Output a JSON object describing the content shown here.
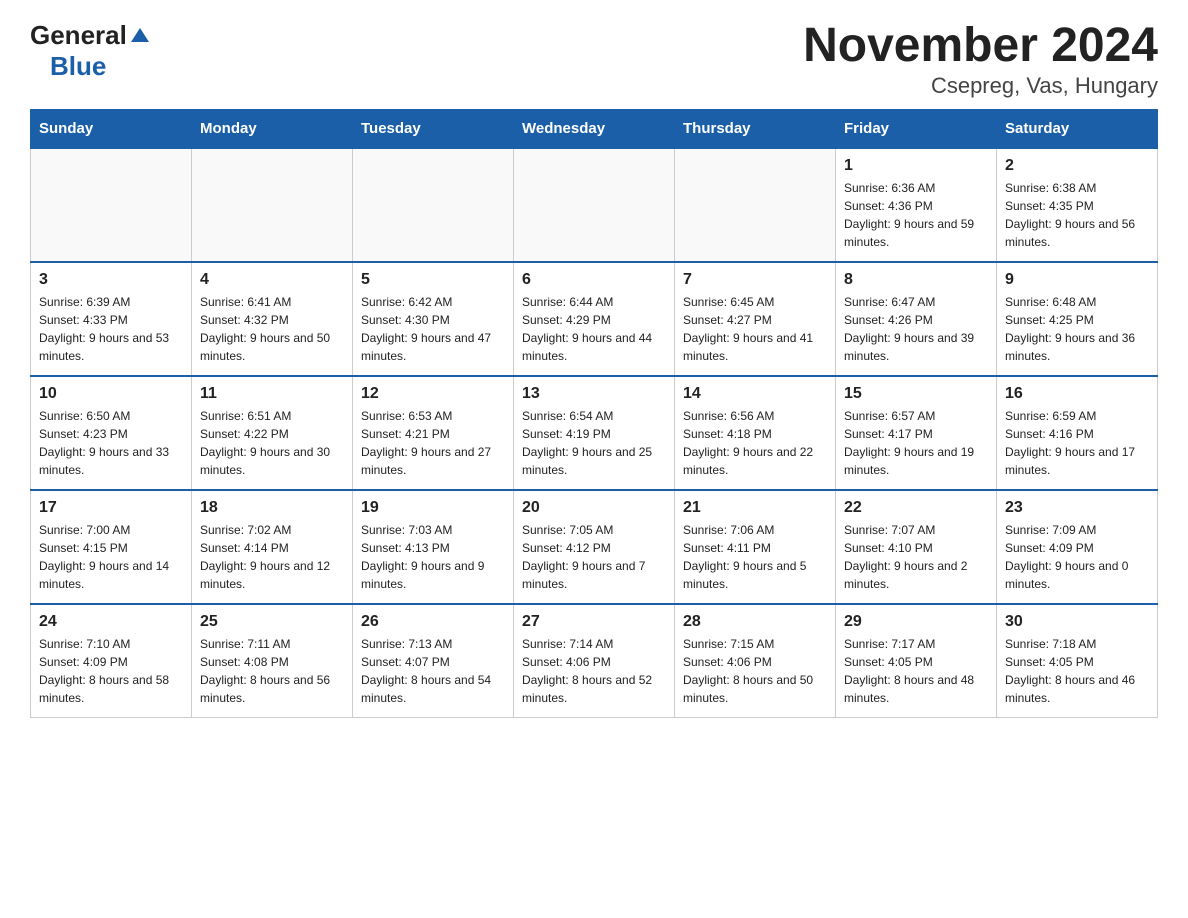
{
  "header": {
    "logo_general": "General",
    "logo_blue": "Blue",
    "title": "November 2024",
    "subtitle": "Csepreg, Vas, Hungary"
  },
  "weekdays": [
    "Sunday",
    "Monday",
    "Tuesday",
    "Wednesday",
    "Thursday",
    "Friday",
    "Saturday"
  ],
  "weeks": [
    [
      {
        "day": "",
        "sunrise": "",
        "sunset": "",
        "daylight": ""
      },
      {
        "day": "",
        "sunrise": "",
        "sunset": "",
        "daylight": ""
      },
      {
        "day": "",
        "sunrise": "",
        "sunset": "",
        "daylight": ""
      },
      {
        "day": "",
        "sunrise": "",
        "sunset": "",
        "daylight": ""
      },
      {
        "day": "",
        "sunrise": "",
        "sunset": "",
        "daylight": ""
      },
      {
        "day": "1",
        "sunrise": "Sunrise: 6:36 AM",
        "sunset": "Sunset: 4:36 PM",
        "daylight": "Daylight: 9 hours and 59 minutes."
      },
      {
        "day": "2",
        "sunrise": "Sunrise: 6:38 AM",
        "sunset": "Sunset: 4:35 PM",
        "daylight": "Daylight: 9 hours and 56 minutes."
      }
    ],
    [
      {
        "day": "3",
        "sunrise": "Sunrise: 6:39 AM",
        "sunset": "Sunset: 4:33 PM",
        "daylight": "Daylight: 9 hours and 53 minutes."
      },
      {
        "day": "4",
        "sunrise": "Sunrise: 6:41 AM",
        "sunset": "Sunset: 4:32 PM",
        "daylight": "Daylight: 9 hours and 50 minutes."
      },
      {
        "day": "5",
        "sunrise": "Sunrise: 6:42 AM",
        "sunset": "Sunset: 4:30 PM",
        "daylight": "Daylight: 9 hours and 47 minutes."
      },
      {
        "day": "6",
        "sunrise": "Sunrise: 6:44 AM",
        "sunset": "Sunset: 4:29 PM",
        "daylight": "Daylight: 9 hours and 44 minutes."
      },
      {
        "day": "7",
        "sunrise": "Sunrise: 6:45 AM",
        "sunset": "Sunset: 4:27 PM",
        "daylight": "Daylight: 9 hours and 41 minutes."
      },
      {
        "day": "8",
        "sunrise": "Sunrise: 6:47 AM",
        "sunset": "Sunset: 4:26 PM",
        "daylight": "Daylight: 9 hours and 39 minutes."
      },
      {
        "day": "9",
        "sunrise": "Sunrise: 6:48 AM",
        "sunset": "Sunset: 4:25 PM",
        "daylight": "Daylight: 9 hours and 36 minutes."
      }
    ],
    [
      {
        "day": "10",
        "sunrise": "Sunrise: 6:50 AM",
        "sunset": "Sunset: 4:23 PM",
        "daylight": "Daylight: 9 hours and 33 minutes."
      },
      {
        "day": "11",
        "sunrise": "Sunrise: 6:51 AM",
        "sunset": "Sunset: 4:22 PM",
        "daylight": "Daylight: 9 hours and 30 minutes."
      },
      {
        "day": "12",
        "sunrise": "Sunrise: 6:53 AM",
        "sunset": "Sunset: 4:21 PM",
        "daylight": "Daylight: 9 hours and 27 minutes."
      },
      {
        "day": "13",
        "sunrise": "Sunrise: 6:54 AM",
        "sunset": "Sunset: 4:19 PM",
        "daylight": "Daylight: 9 hours and 25 minutes."
      },
      {
        "day": "14",
        "sunrise": "Sunrise: 6:56 AM",
        "sunset": "Sunset: 4:18 PM",
        "daylight": "Daylight: 9 hours and 22 minutes."
      },
      {
        "day": "15",
        "sunrise": "Sunrise: 6:57 AM",
        "sunset": "Sunset: 4:17 PM",
        "daylight": "Daylight: 9 hours and 19 minutes."
      },
      {
        "day": "16",
        "sunrise": "Sunrise: 6:59 AM",
        "sunset": "Sunset: 4:16 PM",
        "daylight": "Daylight: 9 hours and 17 minutes."
      }
    ],
    [
      {
        "day": "17",
        "sunrise": "Sunrise: 7:00 AM",
        "sunset": "Sunset: 4:15 PM",
        "daylight": "Daylight: 9 hours and 14 minutes."
      },
      {
        "day": "18",
        "sunrise": "Sunrise: 7:02 AM",
        "sunset": "Sunset: 4:14 PM",
        "daylight": "Daylight: 9 hours and 12 minutes."
      },
      {
        "day": "19",
        "sunrise": "Sunrise: 7:03 AM",
        "sunset": "Sunset: 4:13 PM",
        "daylight": "Daylight: 9 hours and 9 minutes."
      },
      {
        "day": "20",
        "sunrise": "Sunrise: 7:05 AM",
        "sunset": "Sunset: 4:12 PM",
        "daylight": "Daylight: 9 hours and 7 minutes."
      },
      {
        "day": "21",
        "sunrise": "Sunrise: 7:06 AM",
        "sunset": "Sunset: 4:11 PM",
        "daylight": "Daylight: 9 hours and 5 minutes."
      },
      {
        "day": "22",
        "sunrise": "Sunrise: 7:07 AM",
        "sunset": "Sunset: 4:10 PM",
        "daylight": "Daylight: 9 hours and 2 minutes."
      },
      {
        "day": "23",
        "sunrise": "Sunrise: 7:09 AM",
        "sunset": "Sunset: 4:09 PM",
        "daylight": "Daylight: 9 hours and 0 minutes."
      }
    ],
    [
      {
        "day": "24",
        "sunrise": "Sunrise: 7:10 AM",
        "sunset": "Sunset: 4:09 PM",
        "daylight": "Daylight: 8 hours and 58 minutes."
      },
      {
        "day": "25",
        "sunrise": "Sunrise: 7:11 AM",
        "sunset": "Sunset: 4:08 PM",
        "daylight": "Daylight: 8 hours and 56 minutes."
      },
      {
        "day": "26",
        "sunrise": "Sunrise: 7:13 AM",
        "sunset": "Sunset: 4:07 PM",
        "daylight": "Daylight: 8 hours and 54 minutes."
      },
      {
        "day": "27",
        "sunrise": "Sunrise: 7:14 AM",
        "sunset": "Sunset: 4:06 PM",
        "daylight": "Daylight: 8 hours and 52 minutes."
      },
      {
        "day": "28",
        "sunrise": "Sunrise: 7:15 AM",
        "sunset": "Sunset: 4:06 PM",
        "daylight": "Daylight: 8 hours and 50 minutes."
      },
      {
        "day": "29",
        "sunrise": "Sunrise: 7:17 AM",
        "sunset": "Sunset: 4:05 PM",
        "daylight": "Daylight: 8 hours and 48 minutes."
      },
      {
        "day": "30",
        "sunrise": "Sunrise: 7:18 AM",
        "sunset": "Sunset: 4:05 PM",
        "daylight": "Daylight: 8 hours and 46 minutes."
      }
    ]
  ]
}
